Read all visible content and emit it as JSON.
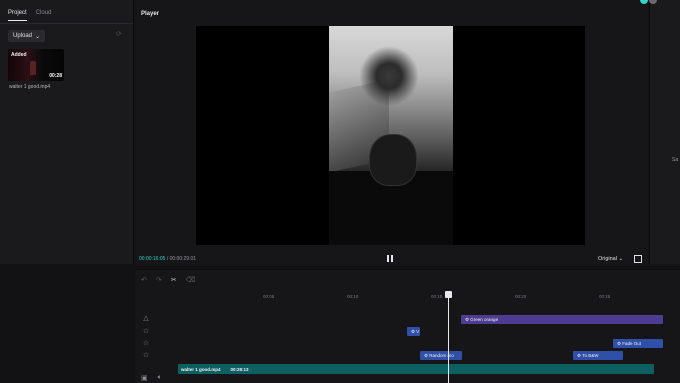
{
  "media_panel": {
    "tabs": [
      "Project",
      "Cloud"
    ],
    "upload_label": "Upload",
    "item": {
      "badge": "Added",
      "duration": "00:28",
      "name": "walter 1 good.mp4"
    }
  },
  "player": {
    "title": "Player",
    "current_time": "00:00:16:05",
    "total_time": "00:00:29:01",
    "ratio": "Original"
  },
  "right_panel": {
    "label": "Sa"
  },
  "timeline": {
    "ruler_labels": [
      "00:05",
      "00:10",
      "00:15",
      "00:20",
      "00:25"
    ],
    "clips": {
      "green_orange": "Green orange",
      "small_effect": "V",
      "fade_out": "Fade Out",
      "random_mo": "Random mo",
      "to_bw": "To B&W",
      "video_name": "walter 1 good.mp4",
      "video_duration": "00:28:13"
    }
  },
  "colors": {
    "accent": "#2dd4c7",
    "effect_clip": "#2f4fa8",
    "filter_clip": "#4c3d93",
    "video_clip": "#0e5f62"
  }
}
